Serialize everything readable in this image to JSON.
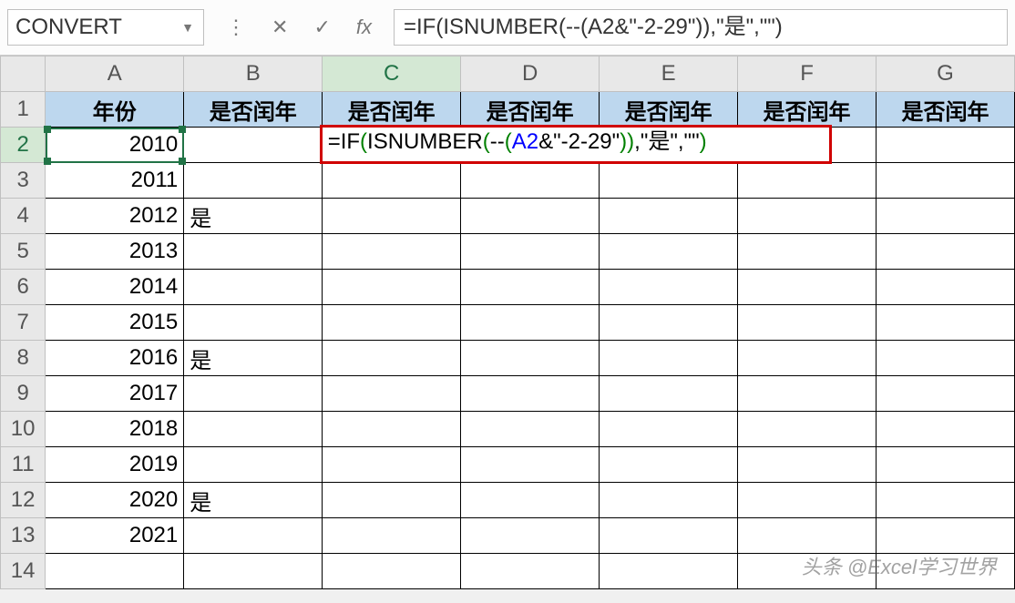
{
  "formula_bar": {
    "name_box": "CONVERT",
    "cancel_glyph": "✕",
    "confirm_glyph": "✓",
    "fx_label": "fx",
    "formula_plain": "=IF(ISNUMBER(--(A2&\"-2-29\")),\"是\",\"\")"
  },
  "columns": [
    "A",
    "B",
    "C",
    "D",
    "E",
    "F",
    "G"
  ],
  "headers": {
    "A": "年份",
    "B": "是否闰年",
    "C": "是否闰年",
    "D": "是否闰年",
    "E": "是否闰年",
    "F": "是否闰年",
    "G": "是否闰年"
  },
  "rows": [
    {
      "r": 2,
      "A": "2010",
      "B": ""
    },
    {
      "r": 3,
      "A": "2011",
      "B": ""
    },
    {
      "r": 4,
      "A": "2012",
      "B": "是"
    },
    {
      "r": 5,
      "A": "2013",
      "B": ""
    },
    {
      "r": 6,
      "A": "2014",
      "B": ""
    },
    {
      "r": 7,
      "A": "2015",
      "B": ""
    },
    {
      "r": 8,
      "A": "2016",
      "B": "是"
    },
    {
      "r": 9,
      "A": "2017",
      "B": ""
    },
    {
      "r": 10,
      "A": "2018",
      "B": ""
    },
    {
      "r": 11,
      "A": "2019",
      "B": ""
    },
    {
      "r": 12,
      "A": "2020",
      "B": "是"
    },
    {
      "r": 13,
      "A": "2021",
      "B": ""
    },
    {
      "r": 14,
      "A": "",
      "B": ""
    }
  ],
  "active_cell": "A2",
  "editing_cell": "C2",
  "editing_formula_html": {
    "eq": "=",
    "if": "IF",
    "isnum": "ISNUMBER",
    "dd": "--",
    "ref": "A2",
    "amp": "&",
    "str": "\"-2-29\"",
    "comma1": ",",
    "res1": "\"是\"",
    "comma2": ",",
    "res2": "\"\""
  },
  "watermark": "头条 @Excel学习世界"
}
